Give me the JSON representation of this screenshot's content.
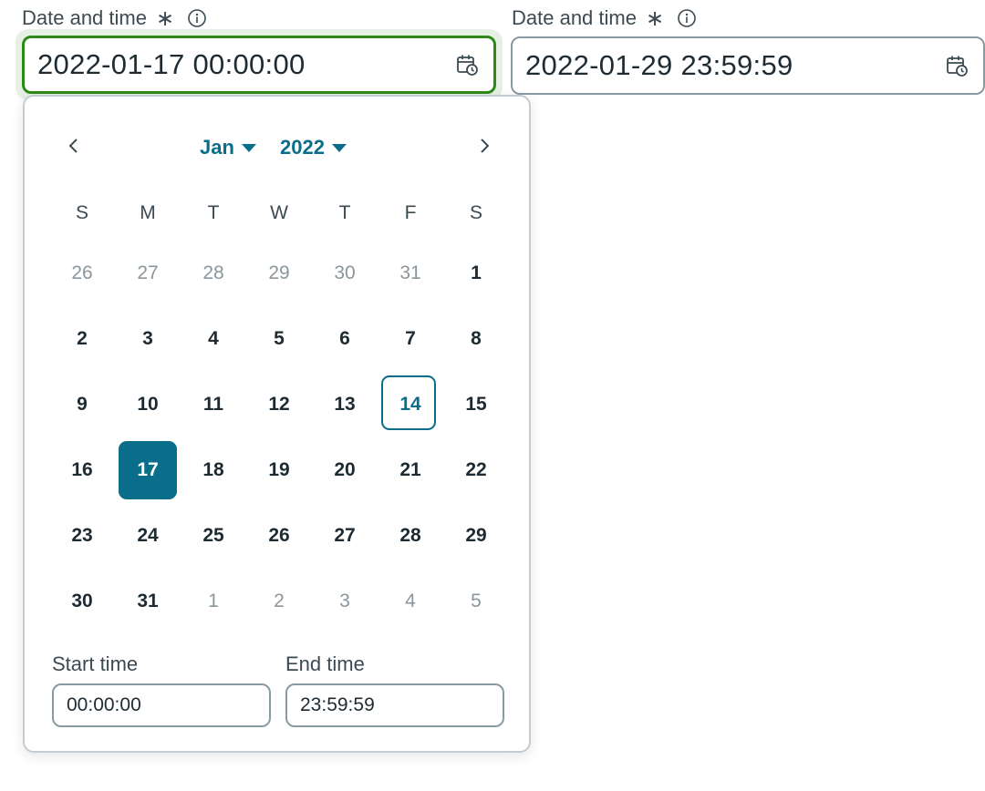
{
  "fields": {
    "start": {
      "label": "Date and time",
      "required_mark": "∗",
      "value": "2022-01-17 00:00:00"
    },
    "end": {
      "label": "Date and time",
      "required_mark": "∗",
      "value": "2022-01-29 23:59:59"
    }
  },
  "calendar": {
    "month": "Jan",
    "year": "2022",
    "weekdays": [
      "S",
      "M",
      "T",
      "W",
      "T",
      "F",
      "S"
    ],
    "days": [
      {
        "label": "26",
        "state": "muted"
      },
      {
        "label": "27",
        "state": "muted"
      },
      {
        "label": "28",
        "state": "muted"
      },
      {
        "label": "29",
        "state": "muted"
      },
      {
        "label": "30",
        "state": "muted"
      },
      {
        "label": "31",
        "state": "muted"
      },
      {
        "label": "1",
        "state": "normal"
      },
      {
        "label": "2",
        "state": "normal"
      },
      {
        "label": "3",
        "state": "normal"
      },
      {
        "label": "4",
        "state": "normal"
      },
      {
        "label": "5",
        "state": "normal"
      },
      {
        "label": "6",
        "state": "normal"
      },
      {
        "label": "7",
        "state": "normal"
      },
      {
        "label": "8",
        "state": "normal"
      },
      {
        "label": "9",
        "state": "normal"
      },
      {
        "label": "10",
        "state": "normal"
      },
      {
        "label": "11",
        "state": "normal"
      },
      {
        "label": "12",
        "state": "normal"
      },
      {
        "label": "13",
        "state": "normal"
      },
      {
        "label": "14",
        "state": "today"
      },
      {
        "label": "15",
        "state": "normal"
      },
      {
        "label": "16",
        "state": "normal"
      },
      {
        "label": "17",
        "state": "selected"
      },
      {
        "label": "18",
        "state": "normal"
      },
      {
        "label": "19",
        "state": "normal"
      },
      {
        "label": "20",
        "state": "normal"
      },
      {
        "label": "21",
        "state": "normal"
      },
      {
        "label": "22",
        "state": "normal"
      },
      {
        "label": "23",
        "state": "normal"
      },
      {
        "label": "24",
        "state": "normal"
      },
      {
        "label": "25",
        "state": "normal"
      },
      {
        "label": "26",
        "state": "normal"
      },
      {
        "label": "27",
        "state": "normal"
      },
      {
        "label": "28",
        "state": "normal"
      },
      {
        "label": "29",
        "state": "normal"
      },
      {
        "label": "30",
        "state": "normal"
      },
      {
        "label": "31",
        "state": "normal"
      },
      {
        "label": "1",
        "state": "muted"
      },
      {
        "label": "2",
        "state": "muted"
      },
      {
        "label": "3",
        "state": "muted"
      },
      {
        "label": "4",
        "state": "muted"
      },
      {
        "label": "5",
        "state": "muted"
      }
    ]
  },
  "time": {
    "start_label": "Start time",
    "start_value": "00:00:00",
    "end_label": "End time",
    "end_value": "23:59:59"
  },
  "icons": {
    "info": "info-icon",
    "calendar": "calendar-clock-icon",
    "prev": "chevron-left-icon",
    "next": "chevron-right-icon",
    "caret": "caret-down-icon"
  },
  "colors": {
    "accent": "#0a6e8a",
    "focus_border": "#2d8a16",
    "focus_ring": "#e6f0e4",
    "text": "#1e2b33",
    "muted_text": "#8a969d"
  }
}
